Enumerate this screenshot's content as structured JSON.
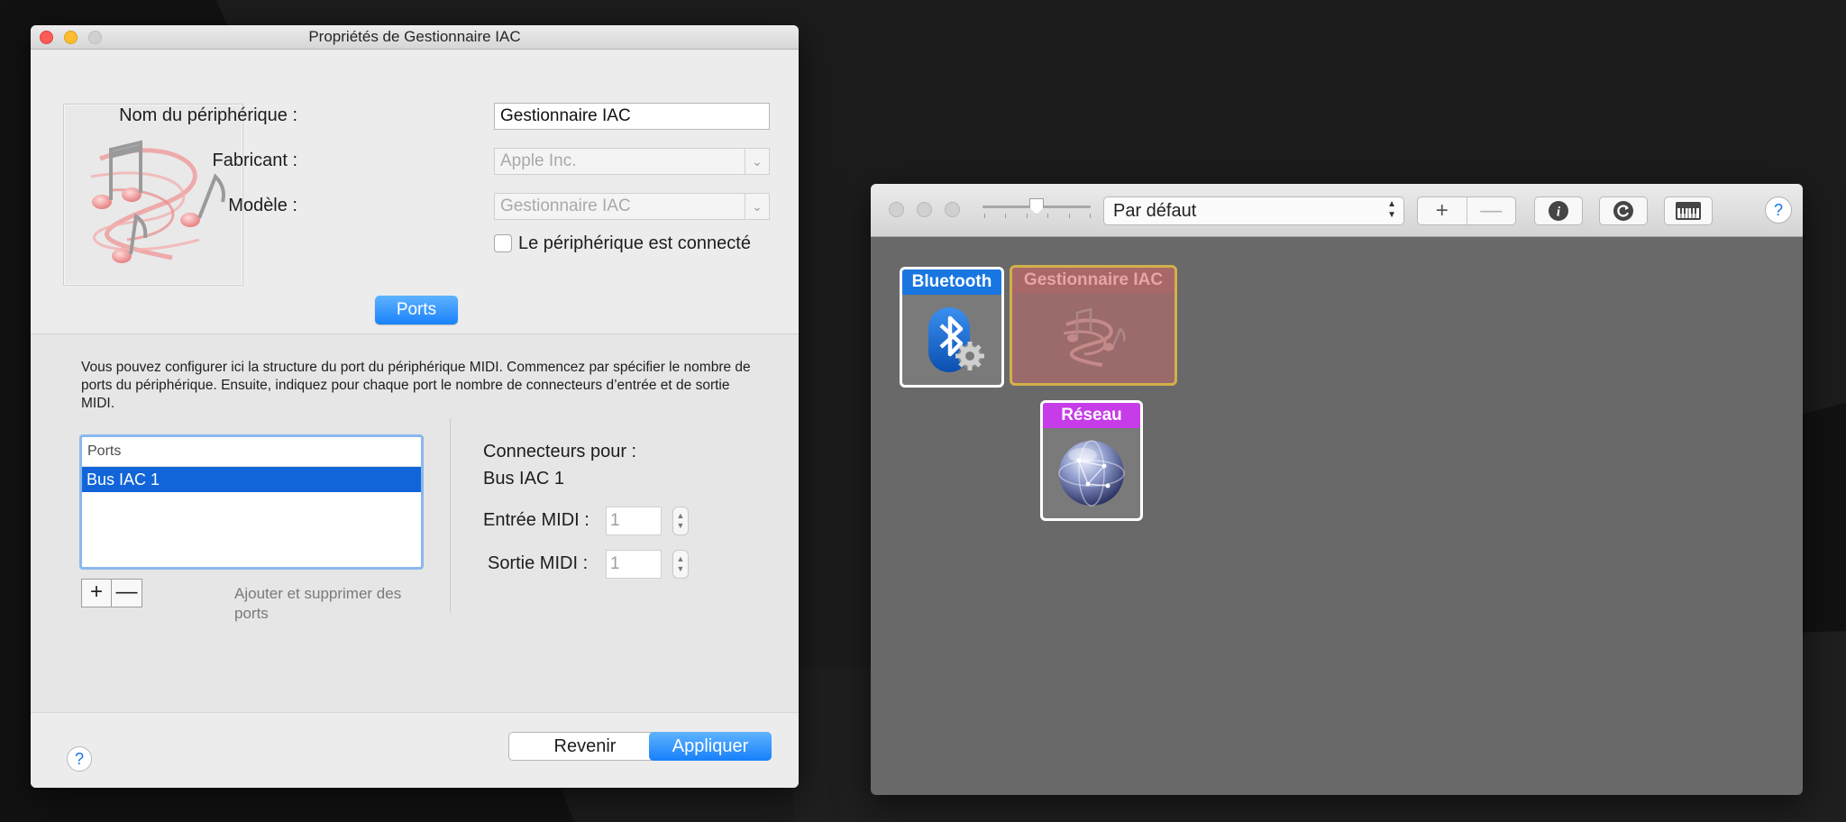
{
  "properties_window": {
    "title": "Propriétés de Gestionnaire IAC",
    "device_name_label": "Nom du périphérique :",
    "device_name_value": "Gestionnaire IAC",
    "manufacturer_label": "Fabricant :",
    "manufacturer_value": "Apple Inc.",
    "model_label": "Modèle :",
    "model_value": "Gestionnaire IAC",
    "online_checkbox_label": "Le périphérique est connecté",
    "ports_tab": "Ports",
    "ports_description": "Vous pouvez configurer ici la structure du port du périphérique MIDI. Commencez par spécifier le nombre de ports du périphérique. Ensuite, indiquez pour chaque port le nombre de connecteurs d’entrée et de sortie MIDI.",
    "ports_list": {
      "header": "Ports",
      "items": [
        "Bus IAC 1"
      ],
      "selected": "Bus IAC 1"
    },
    "add_button": "+",
    "remove_button": "—",
    "add_remove_hint": "Ajouter et supprimer des ports",
    "connectors_title": "Connecteurs pour :",
    "connectors_port": "Bus IAC 1",
    "midi_in_label": "Entrée MIDI :",
    "midi_in_value": "1",
    "midi_out_label": "Sortie MIDI :",
    "midi_out_value": "1",
    "help_label": "?",
    "revert_button": "Revenir",
    "apply_button": "Appliquer"
  },
  "midi_studio": {
    "configuration_select": "Par défaut",
    "add_label": "+",
    "remove_label": "—",
    "help_label": "?",
    "devices": [
      {
        "name": "Bluetooth",
        "color": "#1976e0"
      },
      {
        "name": "Gestionnaire IAC",
        "color": "#d2b04a"
      },
      {
        "name": "Réseau",
        "color": "#c63ce8"
      }
    ]
  },
  "colors": {
    "accent_blue": "#1a82fb",
    "selection_blue": "#1165d8",
    "studio_background": "#696969"
  }
}
